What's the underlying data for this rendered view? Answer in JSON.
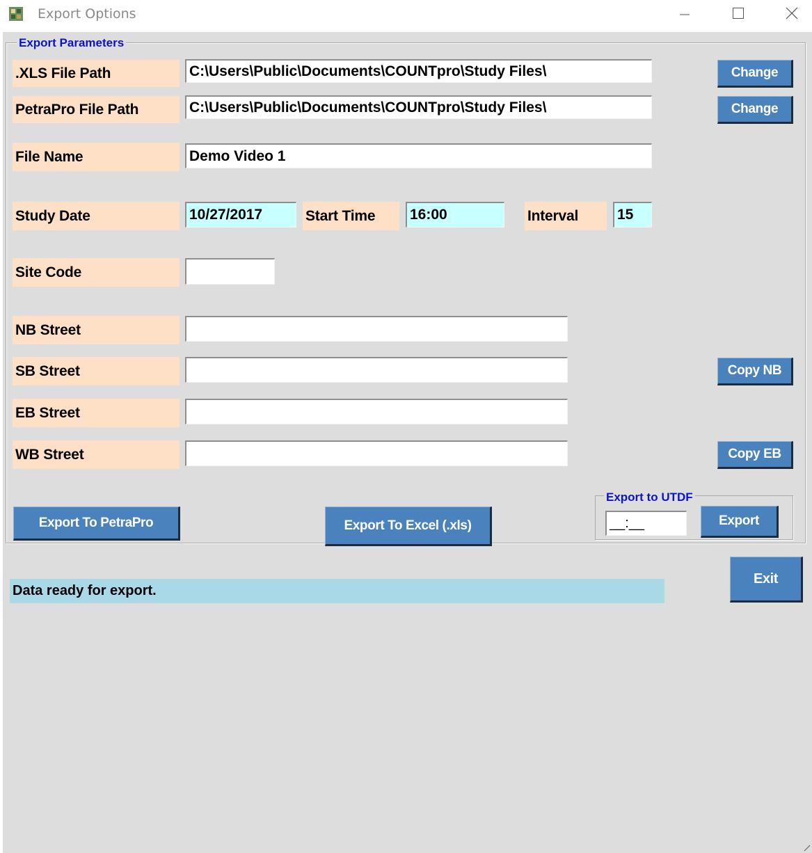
{
  "window": {
    "title": "Export Options",
    "icon": "app-icon",
    "controls": [
      "minimize-icon",
      "maximize-icon",
      "close-icon"
    ]
  },
  "export_parameters": {
    "group_title": "Export Parameters",
    "xls_path": {
      "label": ".XLS File Path",
      "value": "C:\\Users\\Public\\Documents\\COUNTpro\\Study Files\\",
      "button": "Change"
    },
    "petrapro_path": {
      "label": "PetraPro File Path",
      "value": "C:\\Users\\Public\\Documents\\COUNTpro\\Study Files\\",
      "button": "Change"
    },
    "file_name": {
      "label": "File Name",
      "value": "Demo Video 1"
    },
    "study_date": {
      "label": "Study Date",
      "value": "10/27/2017"
    },
    "start_time": {
      "label": "Start Time",
      "value": "16:00"
    },
    "interval": {
      "label": "Interval",
      "value": "15"
    },
    "site_code": {
      "label": "Site Code",
      "value": ""
    },
    "nb_street": {
      "label": "NB Street",
      "value": ""
    },
    "sb_street": {
      "label": "SB Street",
      "value": "",
      "button": "Copy NB"
    },
    "eb_street": {
      "label": "EB Street",
      "value": ""
    },
    "wb_street": {
      "label": "WB Street",
      "value": "",
      "button": "Copy EB"
    },
    "export_petrapro_button": "Export To PetraPro",
    "export_excel_button": "Export To Excel (.xls)",
    "utdf": {
      "title": "Export to UTDF",
      "value": "__:__",
      "button": "Export"
    }
  },
  "exit_button": "Exit",
  "status_text": "Data ready for export.",
  "colors": {
    "label_bg": "#fde0c6",
    "button_bg": "#4a82bd",
    "status_bg": "#a9d8e6",
    "cyan_field": "#c8ffff",
    "group_title": "#0a14c8",
    "window_bg": "#dddddd"
  }
}
